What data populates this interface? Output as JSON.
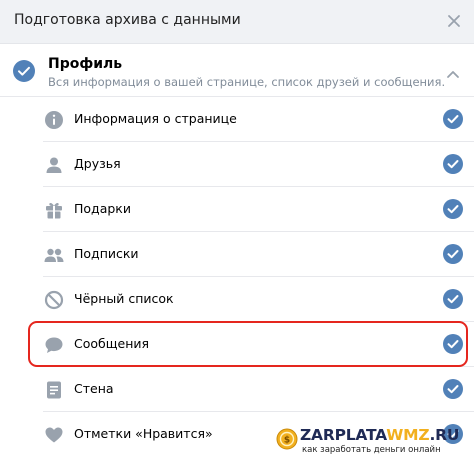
{
  "dialog": {
    "title": "Подготовка архива с данными"
  },
  "section": {
    "title": "Профиль",
    "subtitle": "Вся информация о вашей странице, список друзей и сообщения.",
    "checked": true
  },
  "items": [
    {
      "label": "Информация о странице",
      "icon": "info-icon",
      "checked": true
    },
    {
      "label": "Друзья",
      "icon": "person-icon",
      "checked": true
    },
    {
      "label": "Подарки",
      "icon": "gift-icon",
      "checked": true
    },
    {
      "label": "Подписки",
      "icon": "people-icon",
      "checked": true
    },
    {
      "label": "Чёрный список",
      "icon": "block-icon",
      "checked": true
    },
    {
      "label": "Сообщения",
      "icon": "message-icon",
      "checked": true,
      "highlighted": true
    },
    {
      "label": "Стена",
      "icon": "wall-icon",
      "checked": true
    },
    {
      "label": "Отметки «Нравится»",
      "icon": "heart-icon",
      "checked": true
    }
  ],
  "watermark": {
    "title_main": "ZARPLATA",
    "title_accent": "WMZ",
    "title_end": ".RU",
    "subtitle": "как заработать деньги онлайн"
  },
  "colors": {
    "accent": "#5181b8",
    "icon_gray": "#99a2ad",
    "highlight": "#e5261e"
  }
}
